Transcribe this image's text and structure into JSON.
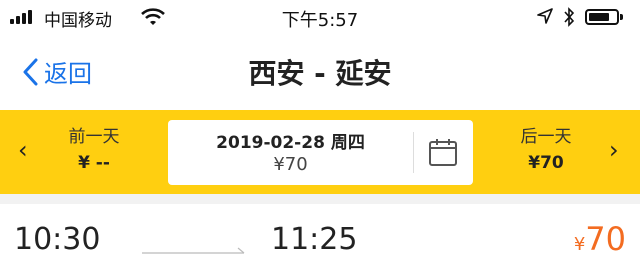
{
  "status_bar": {
    "carrier": "中国移动",
    "time": "下午5:57"
  },
  "nav": {
    "back_label": "返回",
    "title": "西安 - 延安"
  },
  "date_bar": {
    "prev_day": {
      "label": "前一天",
      "price": "¥ --"
    },
    "current": {
      "date": "2019-02-28 周四",
      "price": "¥70"
    },
    "next_day": {
      "label": "后一天",
      "price": "¥70"
    }
  },
  "train": {
    "depart_time": "10:30",
    "arrive_time": "11:25",
    "price_currency": "¥",
    "price_value": "70"
  },
  "colors": {
    "accent_yellow": "#ffcf10",
    "link_blue": "#1a73e8",
    "price_orange": "#f36c21"
  }
}
